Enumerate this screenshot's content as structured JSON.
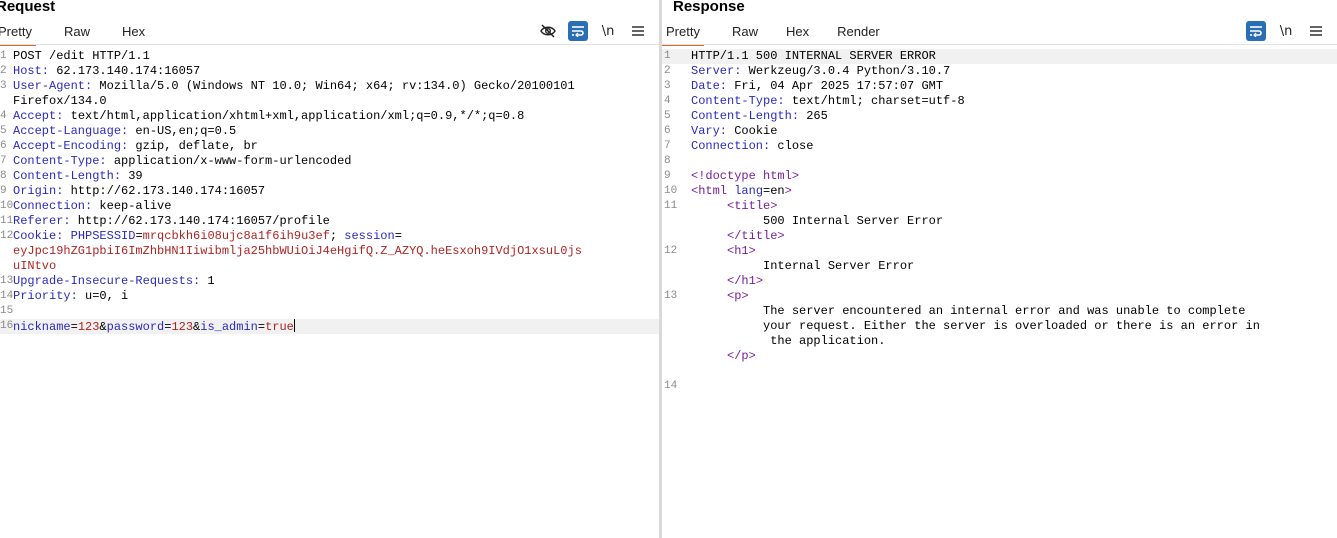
{
  "request": {
    "title": "Request",
    "tabs": [
      "Pretty",
      "Raw",
      "Hex"
    ],
    "lines": [
      {
        "n": "1",
        "parts": [
          {
            "c": "v",
            "t": "POST /edit HTTP/1.1"
          }
        ]
      },
      {
        "n": "2",
        "parts": [
          {
            "c": "k",
            "t": "Host:"
          },
          {
            "c": "v",
            "t": " 62.173.140.174:16057"
          }
        ]
      },
      {
        "n": "3",
        "parts": [
          {
            "c": "k",
            "t": "User-Agent:"
          },
          {
            "c": "v",
            "t": " Mozilla/5.0 (Windows NT 10.0; Win64; x64; rv:134.0) Gecko/20100101"
          }
        ]
      },
      {
        "n": "",
        "parts": [
          {
            "c": "v",
            "t": "Firefox/134.0"
          }
        ]
      },
      {
        "n": "4",
        "parts": [
          {
            "c": "k",
            "t": "Accept:"
          },
          {
            "c": "v",
            "t": " text/html,application/xhtml+xml,application/xml;q=0.9,*/*;q=0.8"
          }
        ]
      },
      {
        "n": "5",
        "parts": [
          {
            "c": "k",
            "t": "Accept-Language:"
          },
          {
            "c": "v",
            "t": " en-US,en;q=0.5"
          }
        ]
      },
      {
        "n": "6",
        "parts": [
          {
            "c": "k",
            "t": "Accept-Encoding:"
          },
          {
            "c": "v",
            "t": " gzip, deflate, br"
          }
        ]
      },
      {
        "n": "7",
        "parts": [
          {
            "c": "k",
            "t": "Content-Type:"
          },
          {
            "c": "v",
            "t": " application/x-www-form-urlencoded"
          }
        ]
      },
      {
        "n": "8",
        "parts": [
          {
            "c": "k",
            "t": "Content-Length:"
          },
          {
            "c": "v",
            "t": " 39"
          }
        ]
      },
      {
        "n": "9",
        "parts": [
          {
            "c": "k",
            "t": "Origin:"
          },
          {
            "c": "v",
            "t": " http://62.173.140.174:16057"
          }
        ]
      },
      {
        "n": "10",
        "parts": [
          {
            "c": "k",
            "t": "Connection:"
          },
          {
            "c": "v",
            "t": " keep-alive"
          }
        ]
      },
      {
        "n": "11",
        "parts": [
          {
            "c": "k",
            "t": "Referer:"
          },
          {
            "c": "v",
            "t": " http://62.173.140.174:16057/profile"
          }
        ]
      },
      {
        "n": "12",
        "parts": [
          {
            "c": "k",
            "t": "Cookie:"
          },
          {
            "c": "v",
            "t": " "
          },
          {
            "c": "ck",
            "t": "PHPSESSID"
          },
          {
            "c": "v",
            "t": "="
          },
          {
            "c": "cv",
            "t": "mrqcbkh6i08ujc8a1f6ih9u3ef"
          },
          {
            "c": "v",
            "t": "; "
          },
          {
            "c": "ck",
            "t": "session"
          },
          {
            "c": "v",
            "t": "="
          }
        ]
      },
      {
        "n": "",
        "parts": [
          {
            "c": "cv",
            "t": "eyJpc19hZG1pbiI6ImZhbHN1Iiwibmlja25hbWUiOiJ4eHgifQ.Z_AZYQ.heEsxoh9IVdjO1xsuL0js"
          }
        ]
      },
      {
        "n": "",
        "parts": [
          {
            "c": "cv",
            "t": "uINtvo"
          }
        ]
      },
      {
        "n": "13",
        "parts": [
          {
            "c": "k",
            "t": "Upgrade-Insecure-Requests:"
          },
          {
            "c": "v",
            "t": " 1"
          }
        ]
      },
      {
        "n": "14",
        "parts": [
          {
            "c": "k",
            "t": "Priority:"
          },
          {
            "c": "v",
            "t": " u=0, i"
          }
        ]
      },
      {
        "n": "15",
        "parts": []
      },
      {
        "n": "16",
        "hl": true,
        "caret": true,
        "parts": [
          {
            "c": "ck",
            "t": "nickname"
          },
          {
            "c": "v",
            "t": "="
          },
          {
            "c": "cv",
            "t": "123"
          },
          {
            "c": "v",
            "t": "&"
          },
          {
            "c": "ck",
            "t": "password"
          },
          {
            "c": "v",
            "t": "="
          },
          {
            "c": "cv",
            "t": "123"
          },
          {
            "c": "v",
            "t": "&"
          },
          {
            "c": "ck",
            "t": "is_admin"
          },
          {
            "c": "v",
            "t": "="
          },
          {
            "c": "cv",
            "t": "true"
          }
        ]
      }
    ]
  },
  "response": {
    "title": "Response",
    "tabs": [
      "Pretty",
      "Raw",
      "Hex",
      "Render"
    ],
    "lines": [
      {
        "n": "1",
        "hl": true,
        "parts": [
          {
            "c": "v",
            "t": "HTTP/1.1 500 INTERNAL SERVER ERROR"
          }
        ]
      },
      {
        "n": "2",
        "parts": [
          {
            "c": "k",
            "t": "Server:"
          },
          {
            "c": "v",
            "t": " Werkzeug/3.0.4 Python/3.10.7"
          }
        ]
      },
      {
        "n": "3",
        "parts": [
          {
            "c": "k",
            "t": "Date:"
          },
          {
            "c": "v",
            "t": " Fri, 04 Apr 2025 17:57:07 GMT"
          }
        ]
      },
      {
        "n": "4",
        "parts": [
          {
            "c": "k",
            "t": "Content-Type:"
          },
          {
            "c": "v",
            "t": " text/html; charset=utf-8"
          }
        ]
      },
      {
        "n": "5",
        "parts": [
          {
            "c": "k",
            "t": "Content-Length:"
          },
          {
            "c": "v",
            "t": " 265"
          }
        ]
      },
      {
        "n": "6",
        "parts": [
          {
            "c": "k",
            "t": "Vary:"
          },
          {
            "c": "v",
            "t": " Cookie"
          }
        ]
      },
      {
        "n": "7",
        "parts": [
          {
            "c": "k",
            "t": "Connection:"
          },
          {
            "c": "v",
            "t": " close"
          }
        ]
      },
      {
        "n": "8",
        "parts": []
      },
      {
        "n": "9",
        "parts": [
          {
            "c": "tag",
            "t": "<!doctype html>"
          }
        ]
      },
      {
        "n": "10",
        "parts": [
          {
            "c": "tag",
            "t": "<html "
          },
          {
            "c": "attr",
            "t": "lang"
          },
          {
            "c": "v",
            "t": "=en"
          },
          {
            "c": "tag",
            "t": ">"
          }
        ]
      },
      {
        "n": "11",
        "parts": [
          {
            "c": "v",
            "t": "     "
          },
          {
            "c": "tag",
            "t": "<title>"
          }
        ]
      },
      {
        "n": "",
        "parts": [
          {
            "c": "v",
            "t": "          500 Internal Server Error"
          }
        ]
      },
      {
        "n": "",
        "parts": [
          {
            "c": "v",
            "t": "     "
          },
          {
            "c": "tag",
            "t": "</title>"
          }
        ]
      },
      {
        "n": "12",
        "parts": [
          {
            "c": "v",
            "t": "     "
          },
          {
            "c": "tag",
            "t": "<h1>"
          }
        ]
      },
      {
        "n": "",
        "parts": [
          {
            "c": "v",
            "t": "          Internal Server Error"
          }
        ]
      },
      {
        "n": "",
        "parts": [
          {
            "c": "v",
            "t": "     "
          },
          {
            "c": "tag",
            "t": "</h1>"
          }
        ]
      },
      {
        "n": "13",
        "parts": [
          {
            "c": "v",
            "t": "     "
          },
          {
            "c": "tag",
            "t": "<p>"
          }
        ]
      },
      {
        "n": "",
        "parts": [
          {
            "c": "v",
            "t": "          The server encountered an internal error and was unable to complete"
          }
        ]
      },
      {
        "n": "",
        "parts": [
          {
            "c": "v",
            "t": "          your request. Either the server is overloaded or there is an error in"
          }
        ]
      },
      {
        "n": "",
        "parts": [
          {
            "c": "v",
            "t": "           the application."
          }
        ]
      },
      {
        "n": "",
        "parts": [
          {
            "c": "v",
            "t": "     "
          },
          {
            "c": "tag",
            "t": "</p>"
          }
        ]
      },
      {
        "n": "",
        "parts": []
      },
      {
        "n": "14",
        "parts": []
      }
    ]
  },
  "toolbar": {
    "hide_icon": "eye-slash-icon",
    "wrap_icon": "wrap-lines-icon",
    "newline_label": "\\n",
    "menu_icon": "hamburger-menu-icon",
    "accent_color": "#2a6fb5",
    "active_tab_color": "#e8642c"
  }
}
